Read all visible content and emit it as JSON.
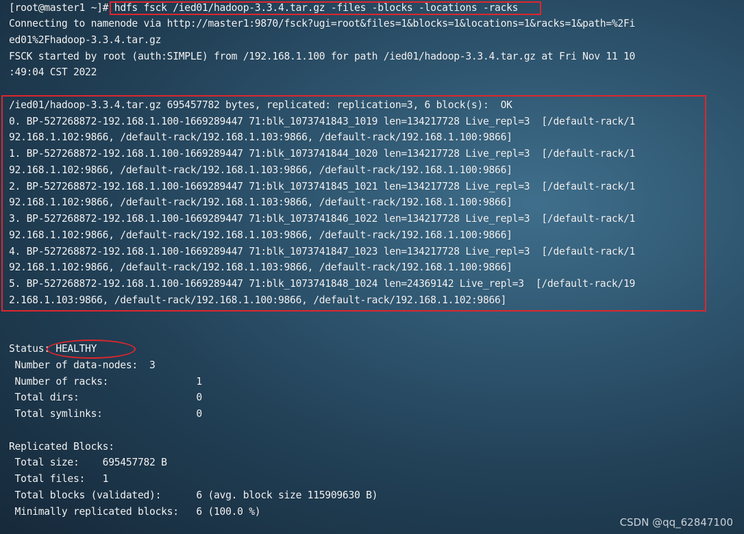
{
  "terminal": {
    "prompt": "[root@master1 ~]# ",
    "command": "hdfs fsck /ied01/hadoop-3.3.4.tar.gz -files -blocks -locations -racks",
    "connecting_1": "Connecting to namenode via http://master1:9870/fsck?ugi=root&files=1&blocks=1&locations=1&racks=1&path=%2Fi",
    "connecting_2": "ed01%2Fhadoop-3.3.4.tar.gz",
    "fsck_started_1": "FSCK started by root (auth:SIMPLE) from /192.168.1.100 for path /ied01/hadoop-3.3.4.tar.gz at Fri Nov 11 10",
    "fsck_started_2": ":49:04 CST 2022",
    "file_summary": "/ied01/hadoop-3.3.4.tar.gz 695457782 bytes, replicated: replication=3, 6 block(s):  OK",
    "blocks": [
      {
        "line1": "0. BP-527268872-192.168.1.100-1669289447 71:blk_1073741843_1019 len=134217728 Live_repl=3  [/default-rack/1",
        "line2": "92.168.1.102:9866, /default-rack/192.168.1.103:9866, /default-rack/192.168.1.100:9866]"
      },
      {
        "line1": "1. BP-527268872-192.168.1.100-1669289447 71:blk_1073741844_1020 len=134217728 Live_repl=3  [/default-rack/1",
        "line2": "92.168.1.102:9866, /default-rack/192.168.1.103:9866, /default-rack/192.168.1.100:9866]"
      },
      {
        "line1": "2. BP-527268872-192.168.1.100-1669289447 71:blk_1073741845_1021 len=134217728 Live_repl=3  [/default-rack/1",
        "line2": "92.168.1.102:9866, /default-rack/192.168.1.103:9866, /default-rack/192.168.1.100:9866]"
      },
      {
        "line1": "3. BP-527268872-192.168.1.100-1669289447 71:blk_1073741846_1022 len=134217728 Live_repl=3  [/default-rack/1",
        "line2": "92.168.1.102:9866, /default-rack/192.168.1.103:9866, /default-rack/192.168.1.100:9866]"
      },
      {
        "line1": "4. BP-527268872-192.168.1.100-1669289447 71:blk_1073741847_1023 len=134217728 Live_repl=3  [/default-rack/1",
        "line2": "92.168.1.102:9866, /default-rack/192.168.1.103:9866, /default-rack/192.168.1.100:9866]"
      },
      {
        "line1": "5. BP-527268872-192.168.1.100-1669289447 71:blk_1073741848_1024 len=24369142 Live_repl=3  [/default-rack/19",
        "line2": "2.168.1.103:9866, /default-rack/192.168.1.100:9866, /default-rack/192.168.1.102:9866]"
      }
    ],
    "status_label": "Status: ",
    "status_value": "HEALTHY",
    "stats": [
      " Number of data-nodes:  3",
      " Number of racks:               1",
      " Total dirs:                    0",
      " Total symlinks:                0"
    ],
    "replicated_header": "Replicated Blocks:",
    "replicated": [
      " Total size:    695457782 B",
      " Total files:   1",
      " Total blocks (validated):      6 (avg. block size 115909630 B)",
      " Minimally replicated blocks:   6 (100.0 %)"
    ]
  },
  "watermark": "CSDN @qq_62847100",
  "colors": {
    "annotation": "#e0262c",
    "text": "#f2f4f6"
  }
}
